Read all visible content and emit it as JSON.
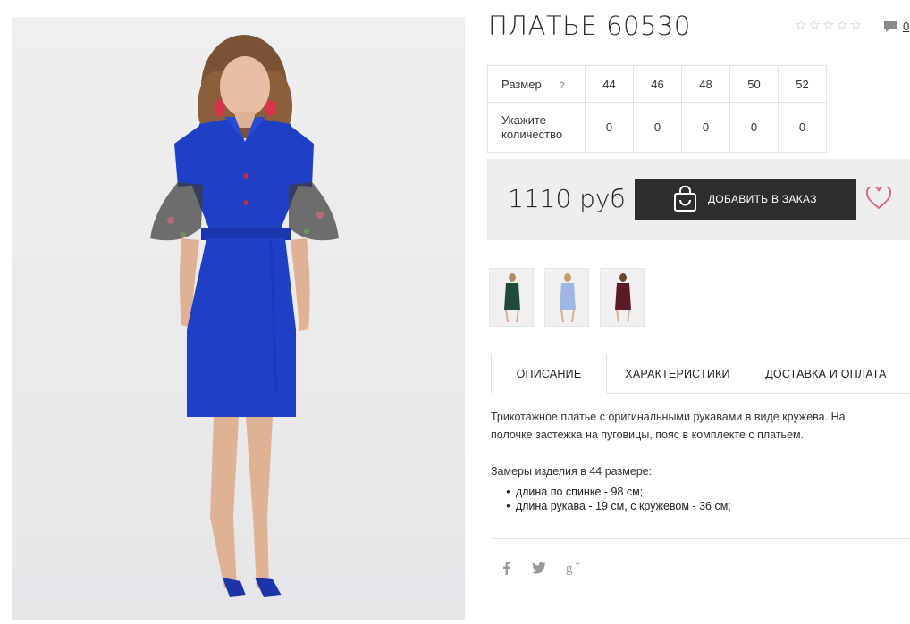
{
  "product": {
    "title": "ПЛАТЬЕ 60530",
    "comments_count": "0"
  },
  "sizes": {
    "header_label": "Размер",
    "help_mark": "?",
    "values": [
      "44",
      "46",
      "48",
      "50",
      "52"
    ],
    "quantity_label_line1": "Укажите",
    "quantity_label_line2": "количество",
    "quantities": [
      "0",
      "0",
      "0",
      "0",
      "0"
    ]
  },
  "pricing": {
    "price": "1110 руб",
    "add_button_label": "ДОБАВИТЬ В ЗАКАЗ"
  },
  "colors": {
    "thumbnails": [
      "green",
      "light-blue",
      "burgundy"
    ],
    "accent_heart": "#d96c7c",
    "button_bg": "#2e2e2e",
    "dress_blue": "#1f3fc4"
  },
  "tabs": {
    "description": "ОПИСАНИЕ",
    "characteristics": "ХАРАКТЕРИСТИКИ",
    "delivery": "ДОСТАВКА И ОПЛАТА"
  },
  "description": {
    "text": "Трикотажное платье с оригинальными рукавами в виде кружева. На полочке застежка на пуговицы, пояс в комплекте с платьем.",
    "measure_title": "Замеры изделия в 44 размере:",
    "measures": [
      "длина по спинке - 98 см;",
      "длина рукава - 19 см, с кружевом - 36 см;"
    ]
  },
  "social": [
    "facebook-icon",
    "twitter-icon",
    "google-plus-icon"
  ]
}
